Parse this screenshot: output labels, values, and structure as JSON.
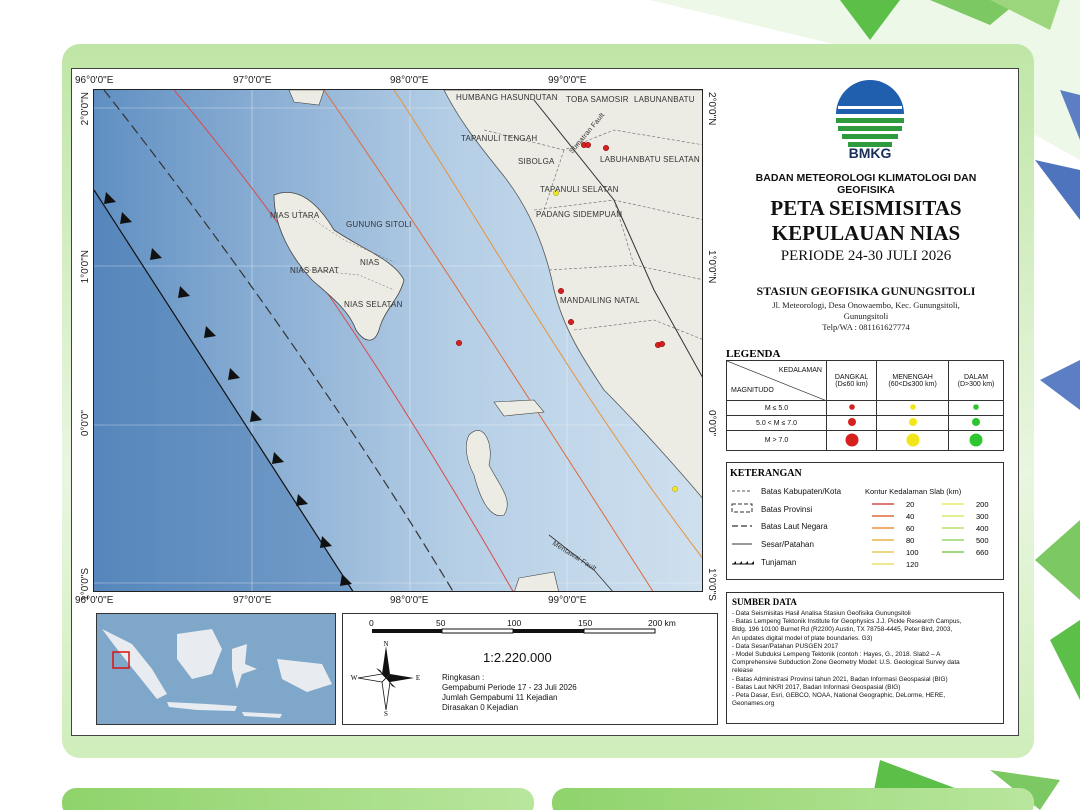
{
  "agency": "BADAN METEOROLOGI KLIMATOLOGI DAN GEOFISIKA",
  "logo_text": "BMKG",
  "title_line1": "PETA SEISMISITAS",
  "title_line2": "KEPULAUAN NIAS",
  "period": "PERIODE 24-30 JULI 2026",
  "station": "STASIUN GEOFISIKA GUNUNGSITOLI",
  "address_line1": "Jl. Meteorologi, Desa Onowaembo, Kec. Gunungsitoli,",
  "address_line2": "Gunungsitoli",
  "address_line3": "Telp/WA : 081161627774",
  "coords": {
    "top": [
      "96°0'0\"E",
      "97°0'0\"E",
      "98°0'0\"E",
      "99°0'0\"E"
    ],
    "bottom": [
      "96°0'0\"E",
      "97°0'0\"E",
      "98°0'0\"E",
      "99°0'0\"E"
    ],
    "left": [
      "2°0'0\"N",
      "1°0'0\"N",
      "0°0'0\"",
      "1°0'0\"S"
    ],
    "right": [
      "2°0'0\"N",
      "1°0'0\"N",
      "0°0'0\"",
      "1°0'0\"S"
    ]
  },
  "map_labels": {
    "nias_utara": "NIAS UTARA",
    "gunung_sitoli": "GUNUNG SITOLI",
    "nias": "NIAS",
    "nias_barat": "NIAS BARAT",
    "nias_selatan": "NIAS SELATAN",
    "humbang": "HUMBANG HASUNDUTAN",
    "toba": "TOBA SAMOSIR",
    "labuhanbatu": "LABUNANBATU",
    "tapanuli_tengah": "TAPANULI TENGAH",
    "sibolga": "SIBOLGA",
    "labuhanbatu_selatan": "LABUHANBATU SELATAN",
    "tapanuli_selatan": "TAPANULI SELATAN",
    "padang_sidempuan": "PADANG SIDEMPUAN",
    "mandailing": "MANDAILING NATAL",
    "sumatran_fault": "Sumatran Fault",
    "mentawai_fault": "Mentawai Fault"
  },
  "legend": {
    "title": "LEGENDA",
    "kedalaman": "KEDALAMAN",
    "magnitudo": "MAGNITUDO",
    "cols": [
      "DANGKAL",
      "(D≤60 km)",
      "MENENGAH",
      "(60<D≤300 km)",
      "DALAM",
      "(D>300 km)"
    ],
    "rows": [
      "M ≤ 5.0",
      "5.0 < M ≤ 7.0",
      "M > 7.0"
    ],
    "colors": [
      "#d62020",
      "#f2e61a",
      "#2ec62e"
    ]
  },
  "keterangan": {
    "title": "KETERANGAN",
    "items": [
      "Batas Kabupaten/Kota",
      "Batas Provinsi",
      "Batas Laut Negara",
      "Sesar/Patahan",
      "Tunjaman"
    ],
    "contour_title": "Kontur Kedalaman Slab (km)",
    "contours_left": [
      "20",
      "40",
      "60",
      "80",
      "100",
      "120"
    ],
    "contours_right": [
      "200",
      "300",
      "400",
      "500",
      "660"
    ],
    "contour_colors_left": [
      "#d94a4a",
      "#e06a3a",
      "#e8923a",
      "#e8b04a",
      "#e9cc5a",
      "#eadf6a"
    ],
    "contour_colors_right": [
      "#e8ea6a",
      "#d4ea6a",
      "#b8e06a",
      "#9ad66a",
      "#7fcc5a"
    ]
  },
  "sumber": {
    "title": "SUMBER DATA",
    "items": [
      "- Data Seismisitas Hasil Analisa Stasiun Geofisika Gunungsitoli",
      "- Batas Lempeng Tektonik Institute for Geophysics J.J. Pickle Research Campus,",
      "  Bldg. 196 10100 Burnet Rd (R2200) Austin, TX 78758-4445, Peter Bird, 2003,",
      "  An updates digital model of plate boundaries. G3)",
      "- Data Sesar/Patahan PUSGEN 2017",
      "- Model Subduksi Lempeng Tektonik (contoh : Hayes, G., 2018. Slab2 – A",
      "  Comprehensive Subduction Zone Geometry Model: U.S. Geological Survey data",
      "  release",
      "- Batas Administrasi Provinsi tahun 2021, Badan Informasi Geospasial (BIG)",
      "- Batas Laut NKRI 2017, Badan Informasi Geospasial (BIG)",
      "- Peta Dasar, Esri, GEBCO, NOAA, National Geographic, DeLorme, HERE,",
      "  Geonames.org"
    ]
  },
  "scale": {
    "ticks": [
      "0",
      "50",
      "100",
      "150",
      "200 km"
    ],
    "ratio": "1:2.220.000",
    "compass": {
      "n": "N",
      "s": "S",
      "e": "E",
      "w": "W"
    }
  },
  "summary": {
    "heading": "Ringkasan :",
    "line1": "Gempabumi Periode 17 - 23 Juli 2026",
    "line2": "Jumlah Gempabumi 11  Kejadian",
    "line3": "Dirasakan 0  Kejadian"
  }
}
